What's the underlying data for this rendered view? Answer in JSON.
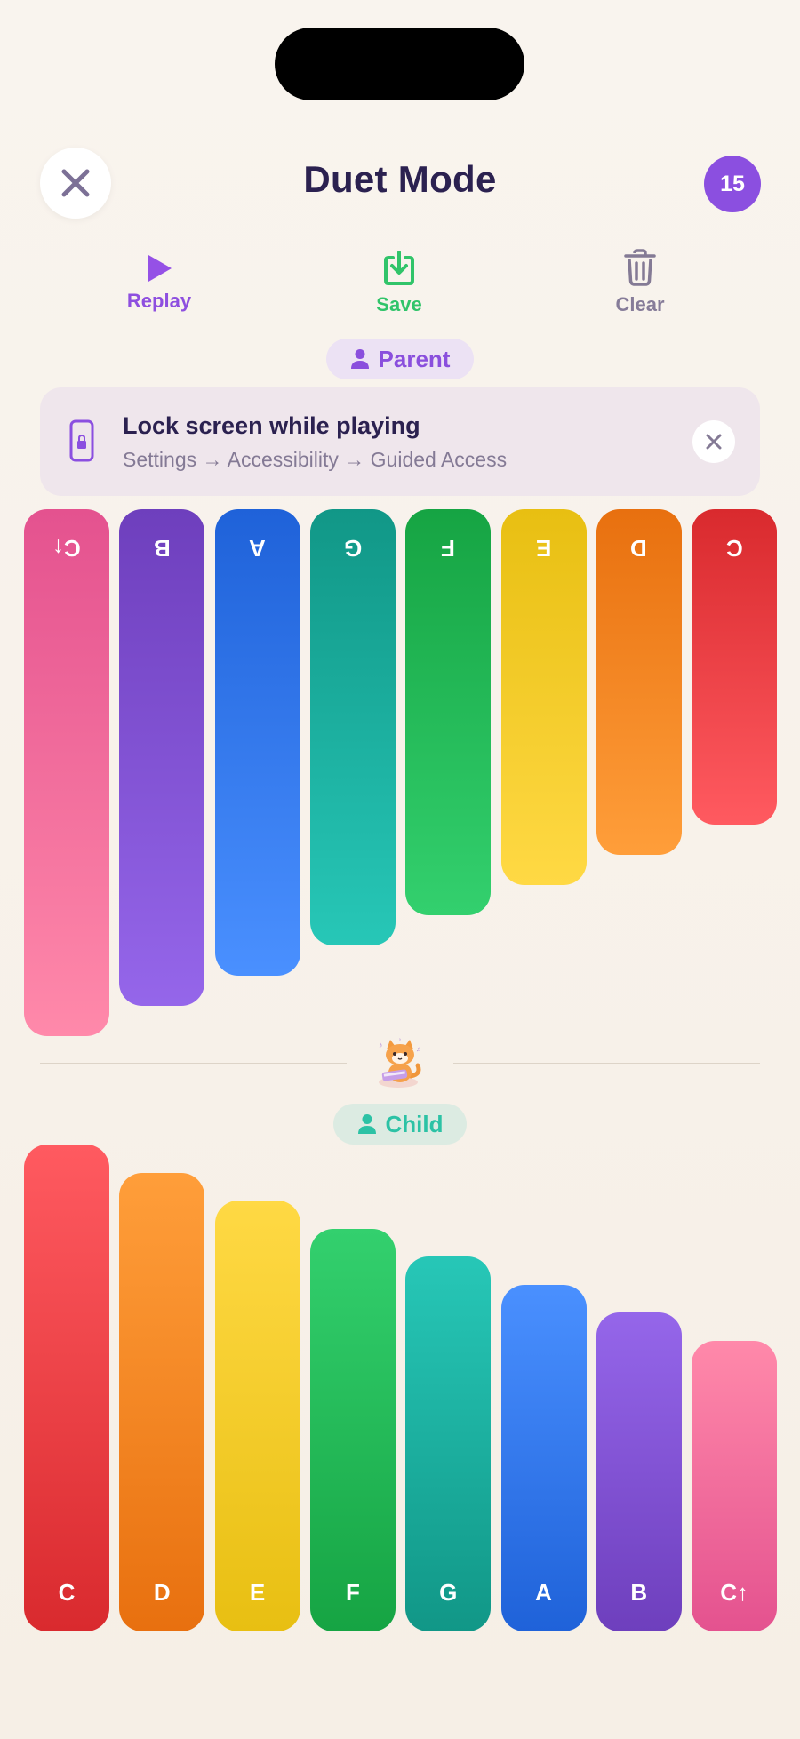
{
  "header": {
    "title": "Duet Mode",
    "count": "15"
  },
  "actions": {
    "replay_label": "Replay",
    "save_label": "Save",
    "clear_label": "Clear"
  },
  "parent_label": "Parent",
  "child_label": "Child",
  "lock_banner": {
    "title": "Lock screen while playing",
    "subtitle": "Settings → Accessibility → Guided Access"
  },
  "keys": [
    {
      "note": "C",
      "top": "#ff5a60",
      "bottom": "#d92a2e"
    },
    {
      "note": "D",
      "top": "#ff9e3a",
      "bottom": "#e8700f"
    },
    {
      "note": "E",
      "top": "#ffd944",
      "bottom": "#e8bf12"
    },
    {
      "note": "F",
      "top": "#33d06e",
      "bottom": "#16a443"
    },
    {
      "note": "G",
      "top": "#27c7b7",
      "bottom": "#119787"
    },
    {
      "note": "A",
      "top": "#4a90ff",
      "bottom": "#1f62d9"
    },
    {
      "note": "B",
      "top": "#9566ea",
      "bottom": "#6e3fbd"
    },
    {
      "note": "C↑",
      "top": "#ff89aa",
      "bottom": "#e4528f"
    }
  ],
  "colors": {
    "accent": "#8b4fe0",
    "save": "#31c46a",
    "child": "#2cc2a5"
  }
}
